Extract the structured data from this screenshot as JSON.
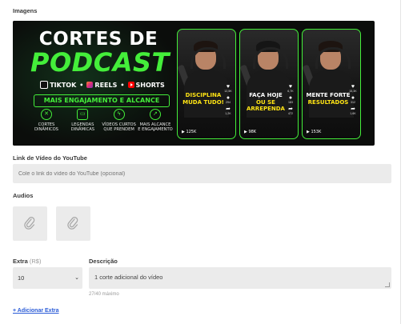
{
  "images_section": {
    "label": "Imagens",
    "banner": {
      "title_line1": "CORTES DE",
      "title_line2": "PODCAST",
      "platforms": [
        {
          "icon": "tiktok-icon",
          "label": "TIKTOK"
        },
        {
          "icon": "reels-icon",
          "label": "REELS"
        },
        {
          "icon": "youtube-shorts-icon",
          "label": "SHORTS"
        }
      ],
      "separator": "•",
      "engagement_label": "MAIS ENGAJAMENTO E ALCANCE",
      "features": [
        {
          "icon": "scissors-icon",
          "glyph": "✕",
          "line1": "CORTES",
          "line2": "DINÂMICOS"
        },
        {
          "icon": "subtitles-icon",
          "glyph": "▭",
          "line1": "LEGENDAS",
          "line2": "DINÂMICAS"
        },
        {
          "icon": "lightning-icon",
          "glyph": "ϟ",
          "line1": "VÍDEOS CURTOS",
          "line2": "QUE PRENDEM"
        },
        {
          "icon": "growth-icon",
          "glyph": "↗",
          "line1": "MAIS ALCANCE",
          "line2": "E ENGAJAMENTO"
        }
      ],
      "cards": [
        {
          "line1": "DISCIPLINA",
          "line2": "MUDA TUDO!",
          "line1_color": "yellow",
          "line2_color": "yellow",
          "likes": "12,5K",
          "comments": "294",
          "shares": "1,2K",
          "views": "125K"
        },
        {
          "line1": "FAÇA HOJE",
          "line2": "OU SE ARREPENDA",
          "line1_color": "white",
          "line2_color": "yellow",
          "likes": "6,7K",
          "comments": "183",
          "shares": "472",
          "views": "98K"
        },
        {
          "line1": "MENTE FORTE",
          "line2": "RESULTADOS",
          "line1_color": "white",
          "line2_color": "yellow",
          "likes": "15,3K",
          "comments": "312",
          "shares": "1,6K",
          "views": "153K"
        }
      ],
      "accent_color": "#44ee3a",
      "caption_yellow": "#ffe414"
    }
  },
  "youtube_link": {
    "label": "Link de Vídeo do YouTube",
    "placeholder": "Cole o link do vídeo do YouTube (opcional)",
    "value": ""
  },
  "audios": {
    "label": "Audios",
    "slots": [
      {
        "icon": "paperclip-icon"
      },
      {
        "icon": "paperclip-icon"
      }
    ]
  },
  "extra": {
    "label": "Extra",
    "currency_hint": "(R$)",
    "selected_value": "10"
  },
  "description": {
    "label": "Descrição",
    "value": "1 corte adicional do vídeo",
    "counter": "27/40 máximo"
  },
  "add_extra_link": "+ Adicionar Extra",
  "colors": {
    "field_background": "#ebebeb",
    "link_blue": "#2a5bd7"
  }
}
